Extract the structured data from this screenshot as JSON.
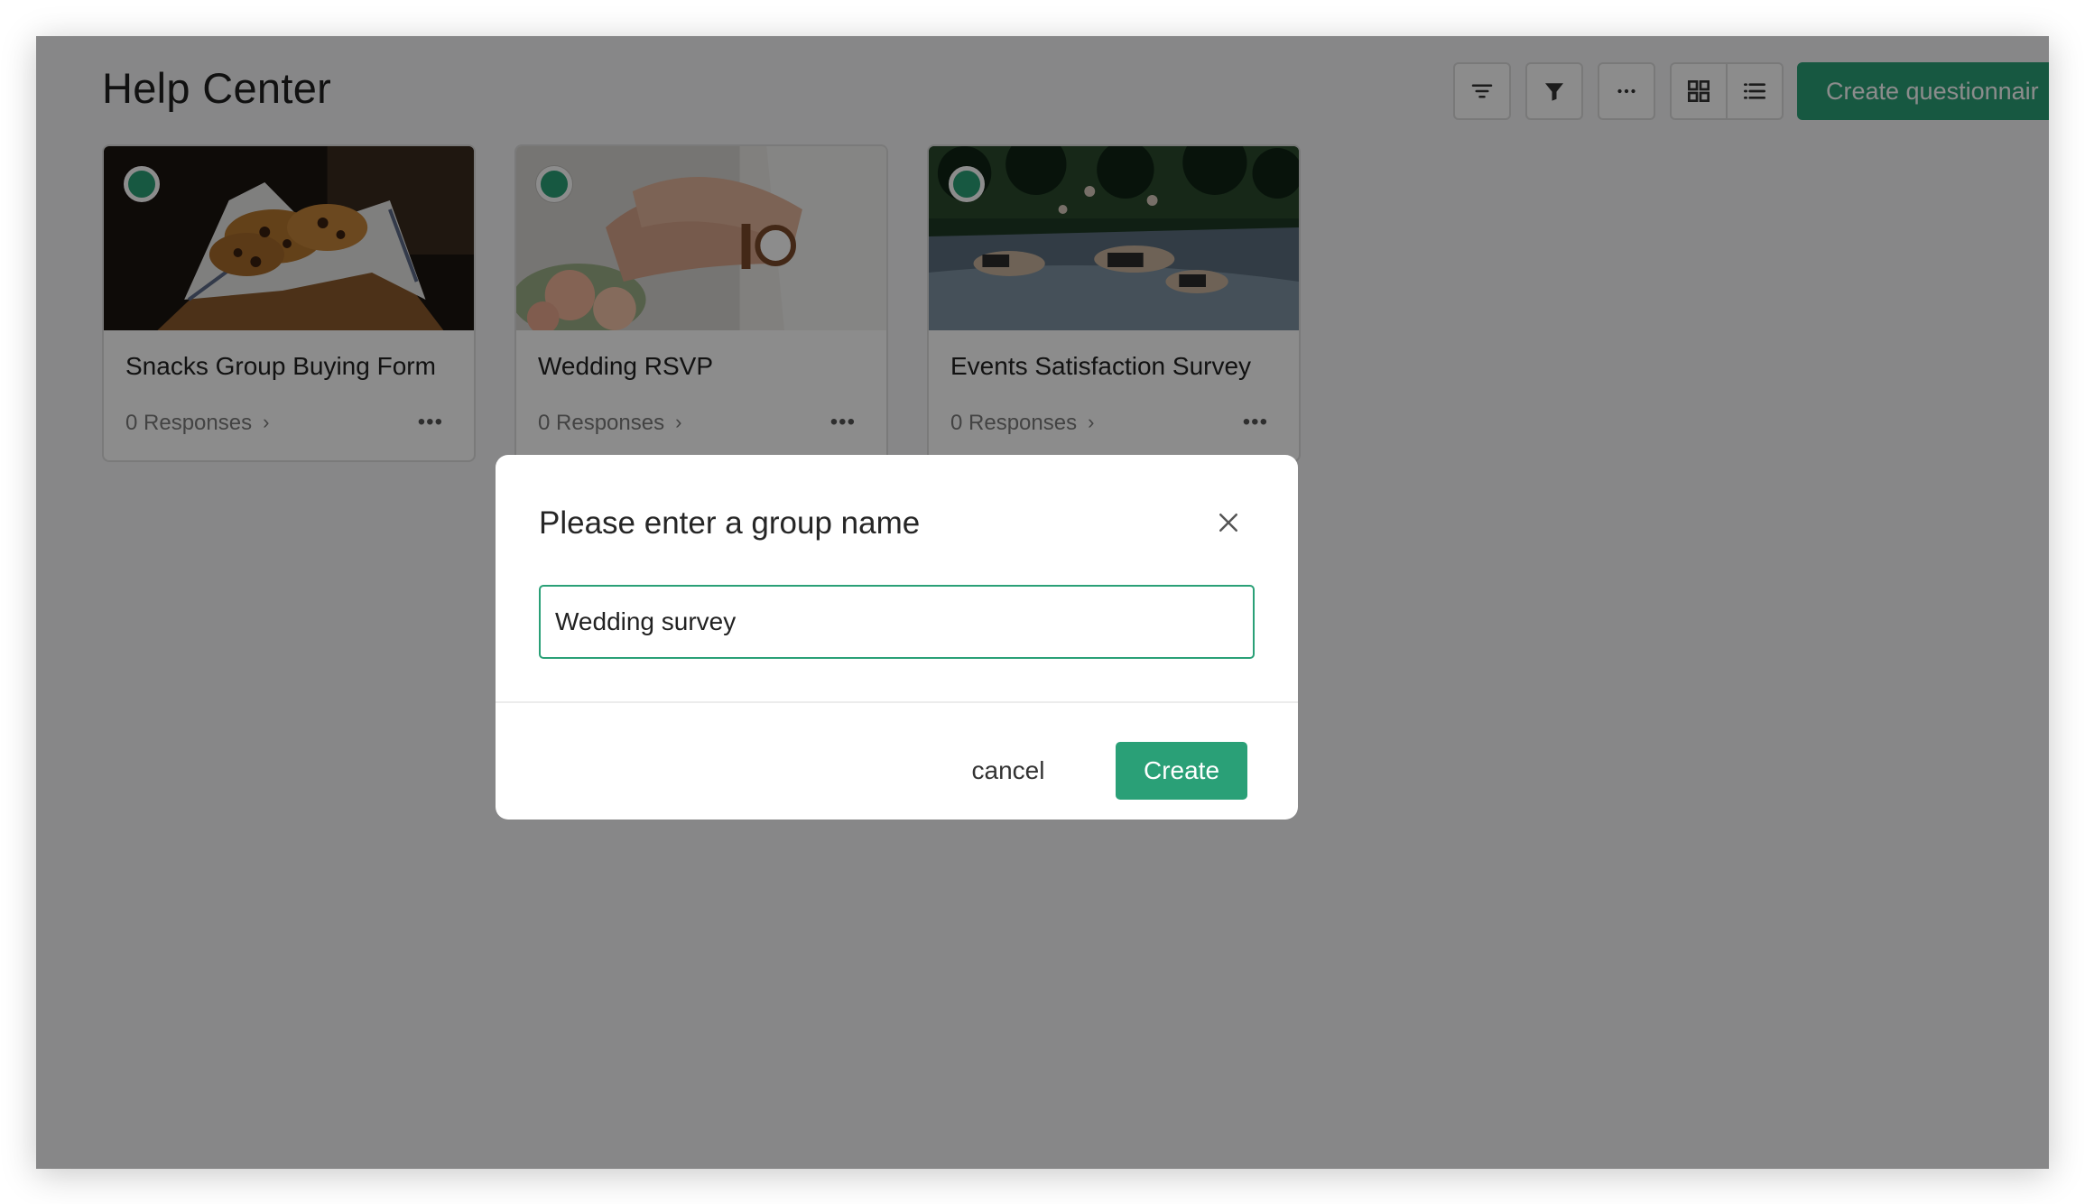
{
  "header": {
    "title": "Help Center",
    "create_label": "Create questionnair"
  },
  "toolbar": {
    "buttons": [
      "sort-icon",
      "filter-icon",
      "more-icon",
      "grid-view-icon",
      "list-view-icon"
    ]
  },
  "cards": [
    {
      "title": "Snacks Group Buying Form",
      "responses": "0 Responses",
      "image": "cookies-in-napkin"
    },
    {
      "title": "Wedding RSVP",
      "responses": "0 Responses",
      "image": "hands-with-rings"
    },
    {
      "title": "Events Satisfaction Survey",
      "responses": "0 Responses",
      "image": "people-on-water-slide"
    }
  ],
  "modal": {
    "title": "Please enter a group name",
    "input_value": "Wedding survey",
    "cancel_label": "cancel",
    "create_label": "Create"
  },
  "colors": {
    "accent": "#2aa077",
    "overlay": "rgba(0,0,0,0.45)"
  }
}
